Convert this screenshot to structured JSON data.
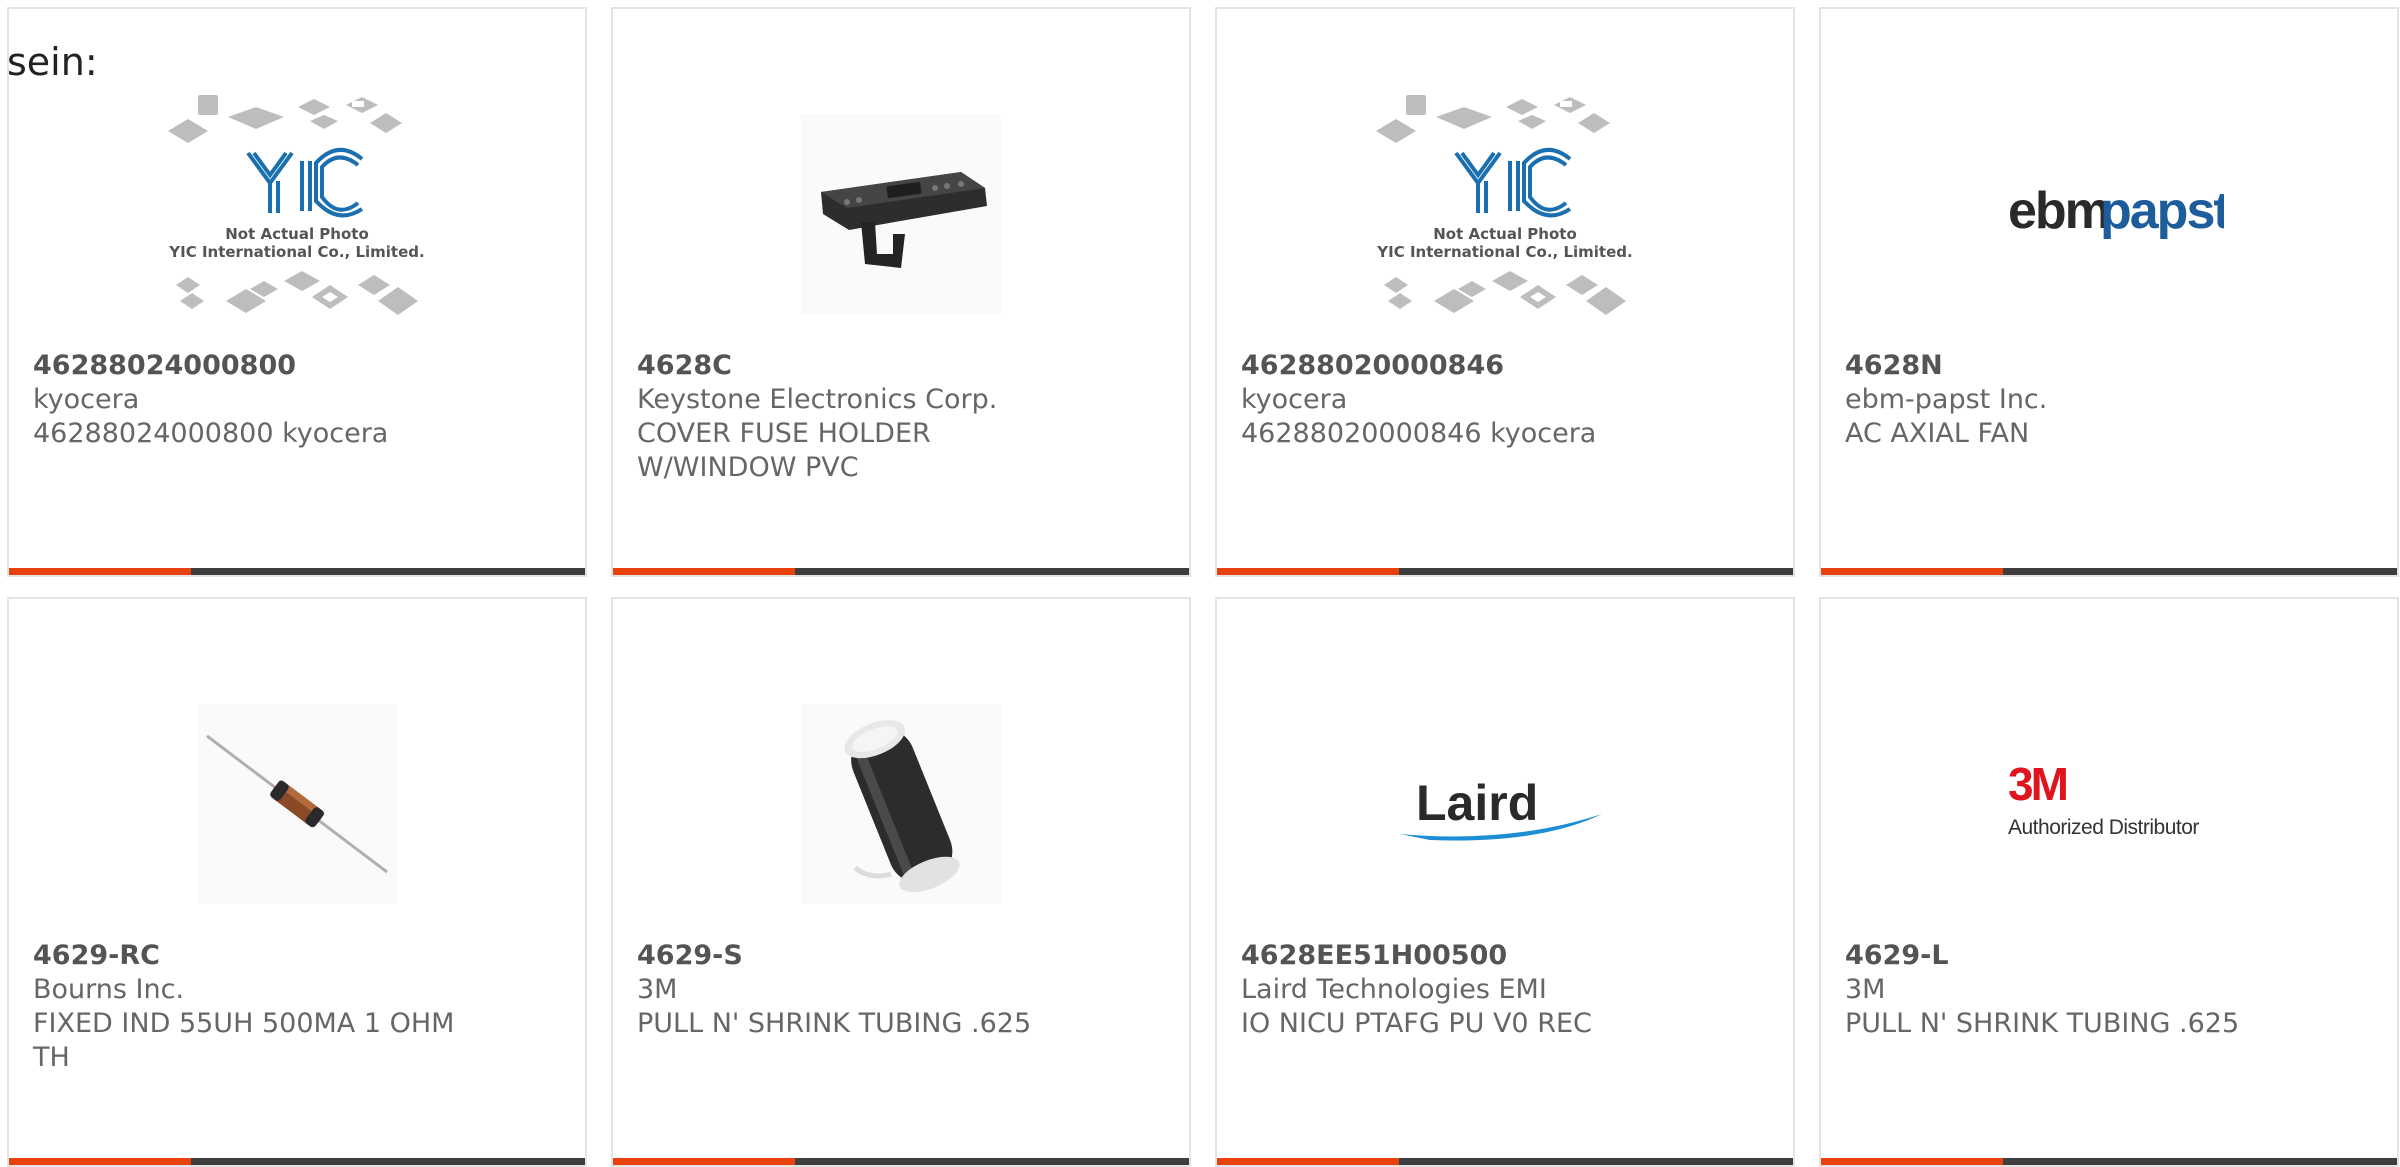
{
  "section_label": "sein:",
  "accent_color": "#e8410c",
  "bar_color": "#3e3e3e",
  "products": [
    {
      "part_number": "46288024000800",
      "manufacturer": "kyocera",
      "description": "46288024000800 kyocera",
      "image": "yic-placeholder-icon",
      "image_text_line1": "Not Actual Photo",
      "image_text_line2": "YIC International Co., Limited.",
      "image_logo": "YIC"
    },
    {
      "part_number": "4628C",
      "manufacturer": "Keystone Electronics Corp.",
      "description": "COVER FUSE HOLDER W/WINDOW PVC",
      "image": "fuse-holder-cover-icon"
    },
    {
      "part_number": "46288020000846",
      "manufacturer": "kyocera",
      "description": "46288020000846 kyocera",
      "image": "yic-placeholder-icon",
      "image_text_line1": "Not Actual Photo",
      "image_text_line2": "YIC International Co., Limited.",
      "image_logo": "YIC"
    },
    {
      "part_number": "4628N",
      "manufacturer": "ebm-papst Inc.",
      "description": "AC AXIAL FAN",
      "image": "ebmpapst-logo-icon",
      "logo_text_a": "ebm",
      "logo_text_b": "papst"
    },
    {
      "part_number": "4629-RC",
      "manufacturer": "Bourns Inc.",
      "description": "FIXED IND 55UH 500MA 1 OHM TH",
      "image": "axial-inductor-icon"
    },
    {
      "part_number": "4629-S",
      "manufacturer": "3M",
      "description": "PULL N' SHRINK TUBING .625",
      "image": "shrink-tubing-icon"
    },
    {
      "part_number": "4628EE51H00500",
      "manufacturer": "Laird Technologies EMI",
      "description": "IO NICU PTAFG PU V0 REC",
      "image": "laird-logo-icon",
      "logo_text": "Laird"
    },
    {
      "part_number": "4629-L",
      "manufacturer": "3M",
      "description": "PULL N' SHRINK TUBING .625",
      "image": "3m-logo-icon",
      "logo_text": "3M",
      "logo_subtext": "Authorized Distributor"
    }
  ]
}
